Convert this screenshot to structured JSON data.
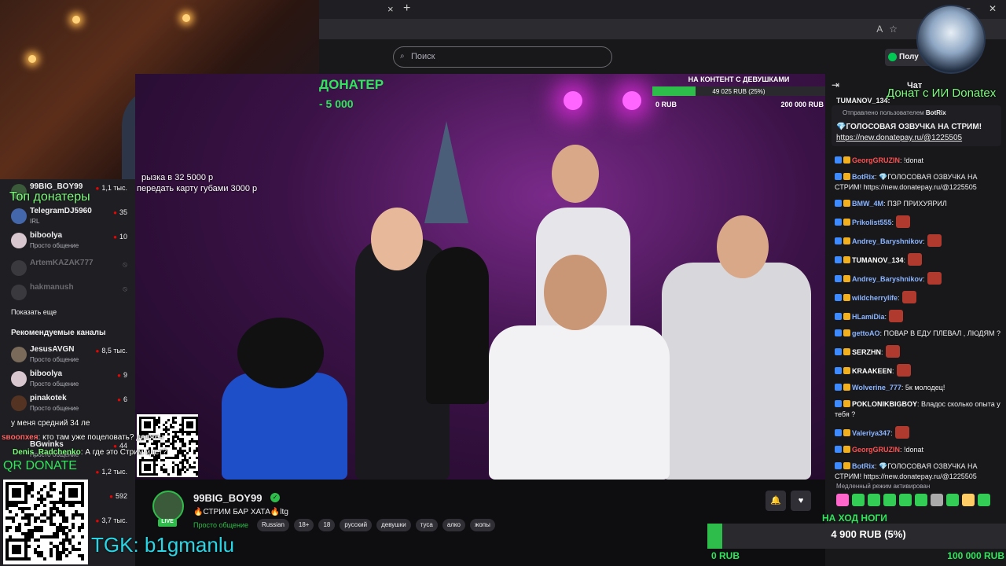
{
  "browser": {
    "close_tab": "×",
    "new_tab": "+",
    "minimize": "−",
    "close": "✕"
  },
  "header": {
    "search_placeholder": "Поиск",
    "login_label": "Полу"
  },
  "sidebar": {
    "top_donaters_overlay": "Топ донатеры",
    "channels": [
      {
        "name": "99BIG_BOY99",
        "viewers": "1,1 тыс.",
        "category": ""
      },
      {
        "name": "TelegramDJ5960",
        "viewers": "35",
        "category": "IRL"
      },
      {
        "name": "biboolya",
        "viewers": "10",
        "category": "Просто общение"
      },
      {
        "name": "ArtemKAZAK777",
        "viewers": "",
        "category": ""
      },
      {
        "name": "hakmanush",
        "viewers": "",
        "category": ""
      }
    ],
    "show_more": "Показать еще",
    "recommended_heading": "Рекомендуемые каналы",
    "recommended": [
      {
        "name": "JesusAVGN",
        "viewers": "8,5 тыс.",
        "category": "Просто общение"
      },
      {
        "name": "biboolya",
        "viewers": "9",
        "category": "Просто общение"
      },
      {
        "name": "pinakotek",
        "viewers": "6",
        "category": "Просто общение"
      },
      {
        "name": "BGwinks",
        "viewers": "44",
        "category": "Просто общение"
      },
      {
        "name": "",
        "viewers": "1,2 тыс.",
        "category": ""
      },
      {
        "name": "",
        "viewers": "592",
        "category": ""
      },
      {
        "name": "",
        "viewers": "3,7 тыс.",
        "category": ""
      }
    ]
  },
  "video": {
    "donater_heading": "ДОНАТЕР",
    "donater_amount": "- 5 000",
    "overlay_line1": "рызка в 32 5000 р",
    "overlay_line2": "передать карту губами 3000 р",
    "goal": {
      "title": "НА КОНТЕНТ С ДЕВУШКАМИ",
      "progress_text": "49 025 RUB (25%)",
      "progress": 0.25,
      "min": "0 RUB",
      "max": "200 000 RUB"
    }
  },
  "overlays": {
    "qr_label": "QR DONATE",
    "tgk": "TGK: b1gmanlu",
    "chat_lines": [
      {
        "user": "",
        "text": "у меня средний 34 ле"
      },
      {
        "user": "sвоопхея",
        "text": ": кто там уже поцеловать? должен"
      },
      {
        "user": "Denis_Radchenko",
        "text": ": А где это Стрим идет?"
      }
    ]
  },
  "stream_info": {
    "streamer": "99BIG_BOY99",
    "live_label": "LIVE",
    "title": "🔥СТРИМ БАР ХАТА🔥ltg",
    "category": "Просто общение",
    "tags": [
      "Russian",
      "18+",
      "18",
      "русский",
      "девушки",
      "туса",
      "алко",
      "жопы"
    ],
    "bell": "🔔",
    "heart": "♥"
  },
  "chat": {
    "title": "Чат",
    "collapse_icon": "⇥",
    "donatex_overlay": "Донат с ИИ Donatex",
    "top_user": "TUMANOV_134:",
    "pinned_by": "Отправлено пользователем",
    "pinned_user": "BotRix",
    "pinned_message": "💎ГОЛОСОВАЯ ОЗВУЧКА НА СТРИМ!",
    "pinned_link": "https://new.donatepay.ru/@1225505",
    "messages": [
      {
        "user": "GeorgGRUZIN",
        "text": ": !donat",
        "color": "#ff4f4f",
        "emote": false
      },
      {
        "user": "BotRix",
        "text": ": 💎ГОЛОСОВАЯ ОЗВУЧКА НА СТРИМ! https://new.donatepay.ru/@1225505",
        "color": "#8ab4ff",
        "emote": false
      },
      {
        "user": "BMW_4M",
        "text": ": ПЗР ПРИХУЯРИЛ",
        "color": "#8ab4ff",
        "emote": false
      },
      {
        "user": "Prikolist555",
        "text": ":",
        "color": "#8ab4ff",
        "emote": true
      },
      {
        "user": "Andrey_Baryshnikov",
        "text": ":",
        "color": "#8ab4ff",
        "emote": true
      },
      {
        "user": "TUMANOV_134",
        "text": ":",
        "color": "#ffffff",
        "emote": true
      },
      {
        "user": "Andrey_Baryshnikov",
        "text": ":",
        "color": "#8ab4ff",
        "emote": true
      },
      {
        "user": "wildcherrylife",
        "text": ":",
        "color": "#8ab4ff",
        "emote": true
      },
      {
        "user": "HLamiDia",
        "text": ":",
        "color": "#8ab4ff",
        "emote": true
      },
      {
        "user": "gettoAO",
        "text": ": ПОВАР В ЕДУ ПЛЕВАЛ , ЛЮДЯМ ?",
        "color": "#8ab4ff",
        "emote": false
      },
      {
        "user": "SERZHN",
        "text": ":",
        "color": "#ffffff",
        "emote": true
      },
      {
        "user": "KRAAKEEN",
        "text": ":",
        "color": "#ffffff",
        "emote": true
      },
      {
        "user": "Wolverine_777",
        "text": ": 5к молодец!",
        "color": "#8ab4ff",
        "emote": false
      },
      {
        "user": "POKLONIKBIGBOY",
        "text": ": Владос сколько опыта у тебя ?",
        "color": "#ffffff",
        "emote": false
      },
      {
        "user": "Valeriya347",
        "text": ":",
        "color": "#8ab4ff",
        "emote": true
      },
      {
        "user": "GeorgGRUZIN",
        "text": ": !donat",
        "color": "#ff4f4f",
        "emote": false
      },
      {
        "user": "BotRix",
        "text": ": 💎ГОЛОСОВАЯ ОЗВУЧКА НА СТРИМ! https://new.donatepay.ru/@1225505",
        "color": "#8ab4ff",
        "emote": false
      }
    ],
    "slow_mode": "Медленный режим активирован"
  },
  "bottom_goal": {
    "title": "НА ХОД НОГИ",
    "progress_text": "4 900 RUB (5%)",
    "progress": 0.05,
    "min": "0 RUB",
    "max": "100 000 RUB"
  },
  "colors": {
    "accent": "#2ebd4a",
    "live": "#eb0400",
    "overlay_green": "#2ee65a",
    "tgk_cyan": "#29d6e6"
  }
}
